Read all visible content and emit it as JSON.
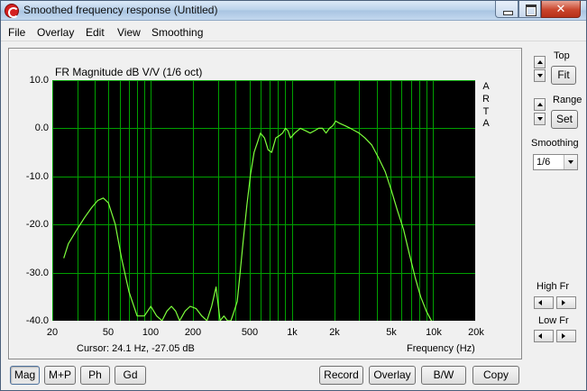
{
  "window": {
    "title": "Smoothed frequency response (Untitled)",
    "close_glyph": "✕"
  },
  "menu": [
    "File",
    "Overlay",
    "Edit",
    "View",
    "Smoothing"
  ],
  "side": {
    "top_label": "Top",
    "fit_button": "Fit",
    "range_label": "Range",
    "set_button": "Set",
    "smoothing_label": "Smoothing",
    "smoothing_value": "1/6",
    "high_fr_label": "High Fr",
    "low_fr_label": "Low Fr"
  },
  "bottom_buttons": {
    "mag": "Mag",
    "mp": "M+P",
    "ph": "Ph",
    "gd": "Gd",
    "record": "Record",
    "overlay": "Overlay",
    "bw": "B/W",
    "copy": "Copy"
  },
  "cursor_readout": "Cursor: 24.1 Hz, -27.05 dB",
  "chart_data": {
    "type": "line",
    "title": "FR Magnitude dB V/V (1/6 oct)",
    "xlabel": "Frequency (Hz)",
    "ylabel": "",
    "x_scale": "log",
    "xlim": [
      20,
      20000
    ],
    "ylim": [
      -40,
      10
    ],
    "x_ticks": [
      "20",
      "50",
      "100",
      "200",
      "500",
      "1k",
      "2k",
      "5k",
      "10k",
      "20k"
    ],
    "x_tick_values": [
      20,
      50,
      100,
      200,
      500,
      1000,
      2000,
      5000,
      10000,
      20000
    ],
    "y_ticks": [
      "10.0",
      "0.0",
      "-10.0",
      "-20.0",
      "-30.0",
      "-40.0"
    ],
    "y_tick_values": [
      10,
      0,
      -10,
      -20,
      -30,
      -40
    ],
    "grid": true,
    "watermark": [
      "A",
      "R",
      "T",
      "A"
    ],
    "colors": {
      "background": "#000000",
      "grid": "#00a000",
      "curve": "#7dff3c"
    },
    "series": [
      {
        "x": [
          24.1,
          26,
          30,
          34,
          38,
          42,
          46,
          50,
          56,
          62,
          70,
          80,
          90,
          100,
          110,
          120,
          130,
          140,
          150,
          160,
          175,
          190,
          210,
          230,
          250,
          270,
          290,
          310,
          330,
          350,
          370,
          390,
          410,
          430,
          450,
          480,
          510,
          540,
          570,
          600,
          640,
          680,
          720,
          770,
          820,
          860,
          900,
          940,
          980,
          1050,
          1150,
          1250,
          1350,
          1450,
          1550,
          1650,
          1750,
          1850,
          1950,
          2050,
          2200,
          2400,
          2600,
          2800,
          3000,
          3300,
          3700,
          4100,
          4600,
          5100,
          5600,
          6200,
          6800,
          7500,
          8200,
          9000,
          10000,
          10500
        ],
        "y": [
          -27,
          -24,
          -21,
          -18.5,
          -16.5,
          -15,
          -14.5,
          -15.5,
          -20,
          -27,
          -34,
          -39,
          -39,
          -37,
          -39,
          -40,
          -38,
          -37,
          -38,
          -40,
          -38,
          -37,
          -37.5,
          -39,
          -40,
          -37,
          -33,
          -40,
          -39,
          -40,
          -40,
          -38,
          -36,
          -30,
          -24,
          -16,
          -9.5,
          -5,
          -3,
          -1,
          -2,
          -4.5,
          -5,
          -2,
          -1.5,
          -1,
          0,
          -0.5,
          -2,
          -1,
          0,
          -0.5,
          -1,
          -0.5,
          0,
          0,
          -1,
          0,
          0.5,
          1.5,
          1,
          0.5,
          0,
          -0.5,
          -1,
          -2,
          -3.5,
          -6,
          -9,
          -13,
          -17,
          -21,
          -26,
          -31,
          -35,
          -38,
          -40.5,
          -41
        ]
      }
    ]
  }
}
